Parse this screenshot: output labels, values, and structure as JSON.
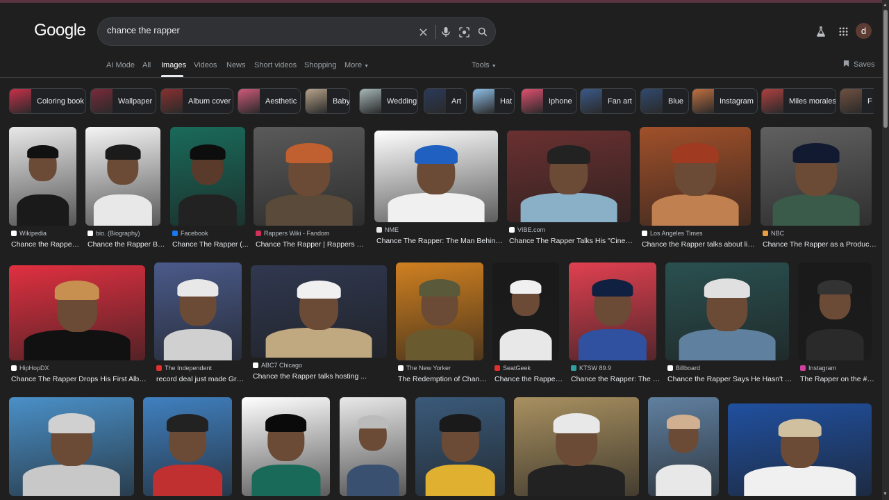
{
  "header": {
    "logo": "Google",
    "search_value": "chance the rapper",
    "avatar_letter": "d"
  },
  "tabs": [
    {
      "label": "AI Mode"
    },
    {
      "label": "All"
    },
    {
      "label": "Images",
      "active": true
    },
    {
      "label": "Videos"
    },
    {
      "label": "News"
    },
    {
      "label": "Short videos"
    },
    {
      "label": "Shopping"
    },
    {
      "label": "More"
    }
  ],
  "tools_label": "Tools",
  "saves_label": "Saves",
  "chips": [
    {
      "label": "Coloring book",
      "color": "#c9304a"
    },
    {
      "label": "Wallpaper",
      "color": "#7a2a3a"
    },
    {
      "label": "Album cover",
      "color": "#8a3030"
    },
    {
      "label": "Aesthetic",
      "color": "#d05a7a"
    },
    {
      "label": "Baby",
      "color": "#b8a48a"
    },
    {
      "label": "Wedding",
      "color": "#a8b8b8"
    },
    {
      "label": "Art",
      "color": "#2a3a5a"
    },
    {
      "label": "Hat",
      "color": "#8fc0e8"
    },
    {
      "label": "Iphone",
      "color": "#e05070"
    },
    {
      "label": "Fan art",
      "color": "#3a5a8a"
    },
    {
      "label": "Blue",
      "color": "#304a70"
    },
    {
      "label": "Instagram",
      "color": "#c07040"
    },
    {
      "label": "Miles morales",
      "color": "#b04040"
    },
    {
      "label": "F",
      "color": "#705040"
    }
  ],
  "results": [
    {
      "source": "Wikipedia",
      "caption": "Chance the Rapper ...",
      "fav": "#ffffff"
    },
    {
      "source": "bio. (Biography)",
      "caption": "Chance the Rapper Bi...",
      "fav": "#ffffff"
    },
    {
      "source": "Facebook",
      "caption": "Chance The Rapper (...",
      "fav": "#1877f2"
    },
    {
      "source": "Rappers Wiki - Fandom",
      "caption": "Chance The Rapper | Rappers Wiki | ...",
      "fav": "#d0305a"
    },
    {
      "source": "NME",
      "caption": "Chance The Rapper: The Man Behind T...",
      "fav": "#e8e8e8"
    },
    {
      "source": "VIBE.com",
      "caption": "Chance The Rapper Talks His \"Cinemati...",
      "fav": "#ffffff"
    },
    {
      "source": "Los Angeles Times",
      "caption": "Chance the Rapper talks about life ...",
      "fav": "#ffffff"
    },
    {
      "source": "NBC",
      "caption": "Chance The Rapper as a Producer: ...",
      "fav": "#e8a040"
    },
    {
      "source": "HipHopDX",
      "caption": "Chance The Rapper Drops His First Album ...",
      "fav": "#ffffff"
    },
    {
      "source": "The Independent",
      "caption": "record deal just made Gra...",
      "fav": "#e03030"
    },
    {
      "source": "ABC7 Chicago",
      "caption": "Chance the Rapper talks hosting ...",
      "fav": "#ffffff"
    },
    {
      "source": "The New Yorker",
      "caption": "The Redemption of Chanc...",
      "fav": "#ffffff"
    },
    {
      "source": "SeatGeek",
      "caption": "Chance the Rapper ...",
      "fav": "#e03030"
    },
    {
      "source": "KTSW 89.9",
      "caption": "Chance the Rapper: The Fo...",
      "fav": "#30a0a0"
    },
    {
      "source": "Billboard",
      "caption": "Chance the Rapper Says He Hasn't Talk...",
      "fav": "#ffffff"
    },
    {
      "source": "Instagram",
      "caption": "The Rapper on the #V...",
      "fav": "#d040a0"
    }
  ],
  "colors": {
    "background": "#1f1f1f",
    "search_bg": "#303134"
  }
}
